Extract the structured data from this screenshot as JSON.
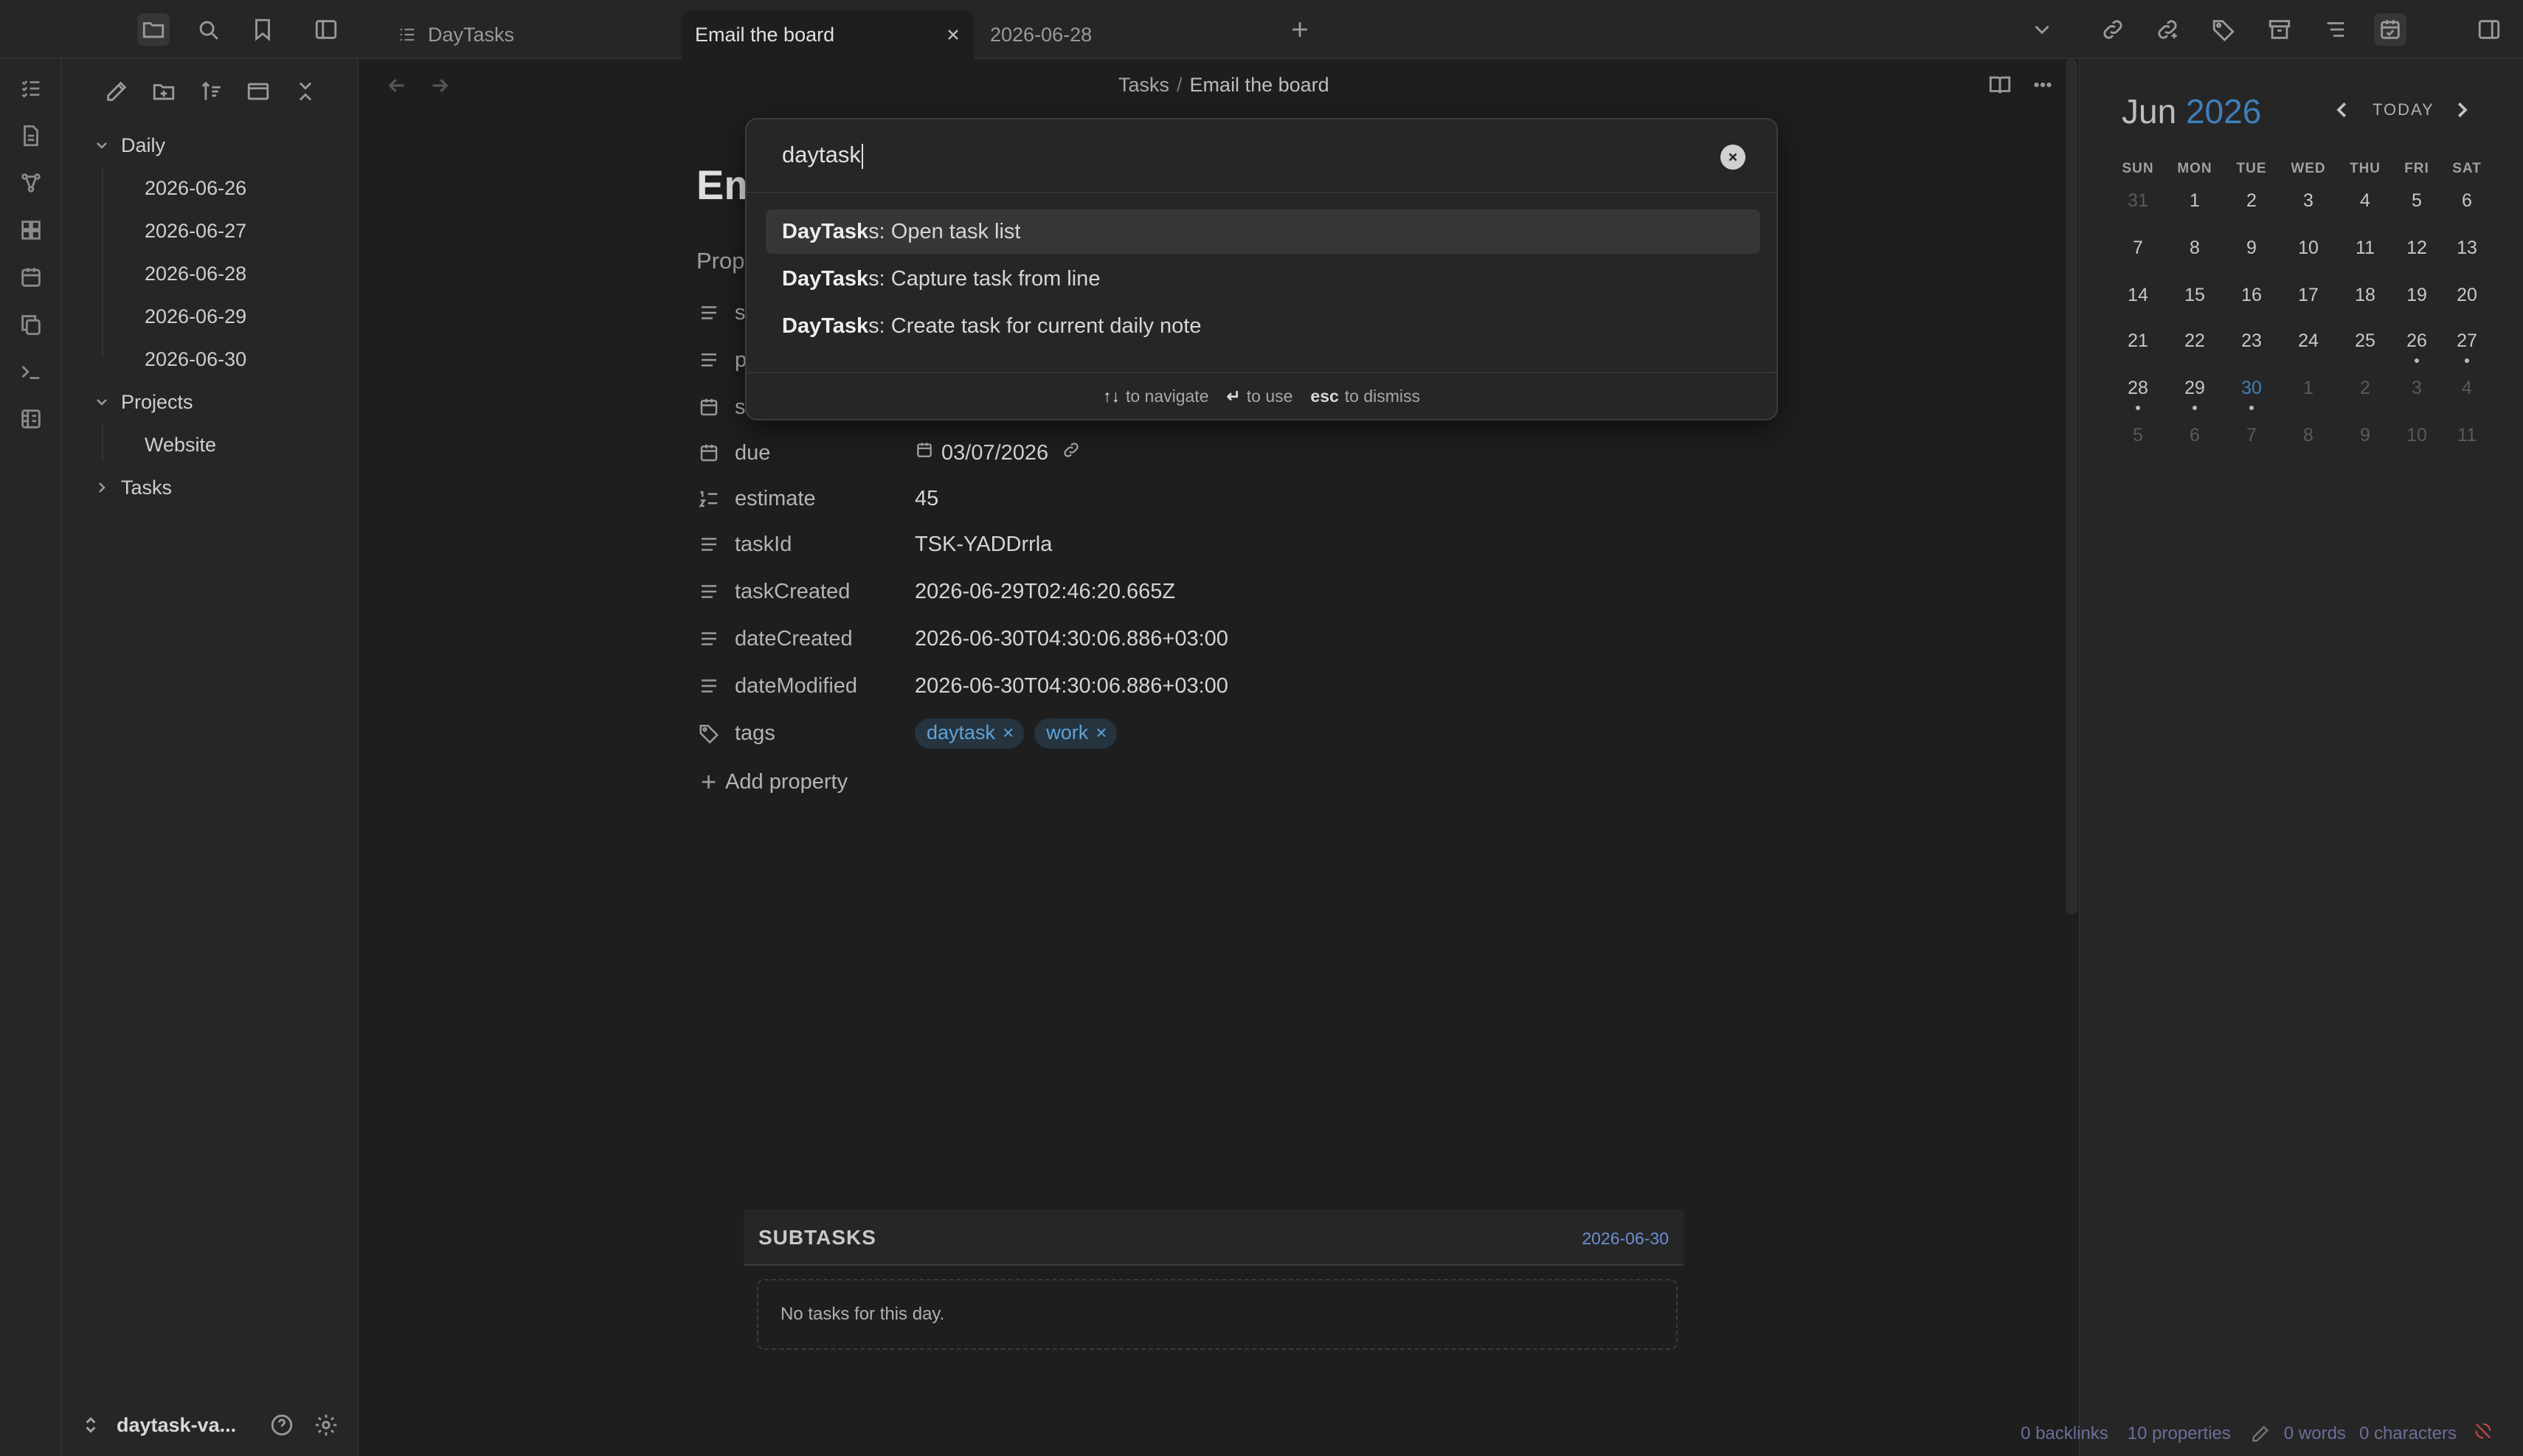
{
  "tabs": [
    {
      "label": "DayTasks"
    },
    {
      "label": "Email the board"
    },
    {
      "label": "2026-06-28"
    }
  ],
  "explorer": {
    "daily_label": "Daily",
    "daily_items": [
      "2026-06-26",
      "2026-06-27",
      "2026-06-28",
      "2026-06-29",
      "2026-06-30"
    ],
    "projects_label": "Projects",
    "projects_items": [
      "Website"
    ],
    "tasks_label": "Tasks",
    "vault_name": "daytask-va..."
  },
  "breadcrumb": {
    "parent": "Tasks",
    "separator": "/",
    "current": "Email the board"
  },
  "note": {
    "title_partial": "Em",
    "properties_heading_partial": "Prop",
    "hidden_keys": [
      "s",
      "p",
      "s"
    ],
    "properties": [
      {
        "key": "due",
        "value": "03/07/2026",
        "icon": "calendar-icon"
      },
      {
        "key": "estimate",
        "value": "45",
        "icon": "number-icon"
      },
      {
        "key": "taskId",
        "value": "TSK-YADDrrla",
        "icon": "text-icon"
      },
      {
        "key": "taskCreated",
        "value": "2026-06-29T02:46:20.665Z",
        "icon": "text-icon"
      },
      {
        "key": "dateCreated",
        "value": "2026-06-30T04:30:06.886+03:00",
        "icon": "text-icon"
      },
      {
        "key": "dateModified",
        "value": "2026-06-30T04:30:06.886+03:00",
        "icon": "text-icon"
      }
    ],
    "tags_key": "tags",
    "tags": [
      "daytask",
      "work"
    ],
    "tag_remove": "×",
    "add_property": "Add property"
  },
  "subtasks": {
    "title": "SUBTASKS",
    "date": "2026-06-30",
    "empty": "No tasks for this day."
  },
  "status": {
    "backlinks": "0 backlinks",
    "properties": "10 properties",
    "words": "0 words",
    "characters": "0 characters"
  },
  "calendar": {
    "month": "Jun",
    "year": "2026",
    "today_label": "TODAY",
    "weekdays": [
      "SUN",
      "MON",
      "TUE",
      "WED",
      "THU",
      "FRI",
      "SAT"
    ],
    "weeks": [
      [
        "31",
        "1",
        "2",
        "3",
        "4",
        "5",
        "6"
      ],
      [
        "7",
        "8",
        "9",
        "10",
        "11",
        "12",
        "13"
      ],
      [
        "14",
        "15",
        "16",
        "17",
        "18",
        "19",
        "20"
      ],
      [
        "21",
        "22",
        "23",
        "24",
        "25",
        "26",
        "27"
      ],
      [
        "28",
        "29",
        "30",
        "1",
        "2",
        "3",
        "4"
      ],
      [
        "5",
        "6",
        "7",
        "8",
        "9",
        "10",
        "11"
      ]
    ]
  },
  "palette": {
    "query": "daytask",
    "suggestions": [
      {
        "match": "DayTask",
        "rest": "s: Open task list"
      },
      {
        "match": "DayTask",
        "rest": "s: Capture task from line"
      },
      {
        "match": "DayTask",
        "rest": "s: Create task for current daily note"
      }
    ],
    "hints": [
      {
        "key": "↑↓",
        "text": "to navigate"
      },
      {
        "key": "↵",
        "text": "to use"
      },
      {
        "key": "esc",
        "text": "to dismiss"
      }
    ]
  },
  "colors": {
    "accent": "#3f7fb8",
    "tag_bg": "#25343f",
    "tag_fg": "#5ea3d9",
    "status_link": "#6a6f9a"
  }
}
